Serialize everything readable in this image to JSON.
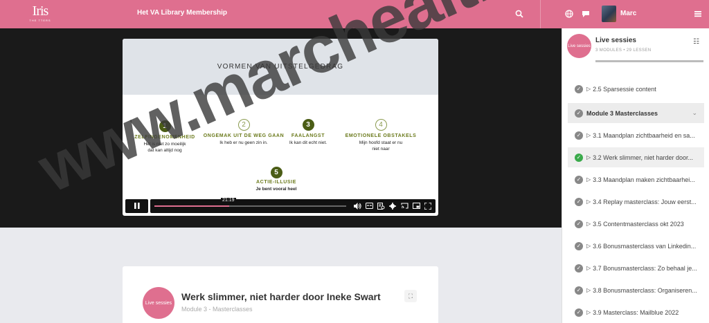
{
  "topbar": {
    "logo_mark": "Iris",
    "logo_sub": "THE TTERS",
    "site_title": "Het VA Library Membership",
    "user_name": "Marc"
  },
  "video": {
    "slide_title": "VORMEN VAN UITSTELGEDRAG",
    "points": [
      {
        "num": "1",
        "title": "ZELFINGENOMENHEID",
        "text": "Het is niet zo moeilijk dat kan altijd nog"
      },
      {
        "num": "2",
        "title": "ONGEMAK UIT DE WEG GAAN",
        "text": "Ik heb er nu geen zin in."
      },
      {
        "num": "3",
        "title": "FAALANGST",
        "text": "Ik kan dit echt niet."
      },
      {
        "num": "4",
        "title": "EMOTIONELE OBSTAKELS",
        "text": "Mijn hoofd staat er nu niet naar"
      },
      {
        "num": "5",
        "title": "ACTIE-ILLUSIE",
        "text": "Je bent vooral heel"
      }
    ],
    "time_tooltip": "21:19",
    "progress_fraction": 0.39
  },
  "lesson": {
    "badge": "Live sessies",
    "title": "Werk slimmer, niet harder door Ineke Swart",
    "subtitle": "Module 3 - Masterclasses"
  },
  "sidebar": {
    "badge": "Live sessies",
    "title": "Live sessies",
    "meta": "3 MODULES • 29 LESSEN",
    "items": [
      {
        "label": "2.5 Sparsessie content",
        "type": "lesson",
        "done": false
      },
      {
        "label": "Module 3   Masterclasses",
        "type": "module",
        "done": false
      },
      {
        "label": "3.1 Maandplan zichtbaarheid en sa...",
        "type": "lesson",
        "done": false
      },
      {
        "label": "3.2 Werk slimmer, niet harder door...",
        "type": "lesson",
        "done": true,
        "active": true
      },
      {
        "label": "3.3 Maandplan maken zichtbaarhei...",
        "type": "lesson",
        "done": false
      },
      {
        "label": "3.4 Replay masterclass: Jouw eerst...",
        "type": "lesson",
        "done": false
      },
      {
        "label": "3.5 Contentmasterclass okt 2023",
        "type": "lesson",
        "done": false
      },
      {
        "label": "3.6 Bonusmasterclass van Linkedin...",
        "type": "lesson",
        "done": false
      },
      {
        "label": "3.7 Bonusmasterclass: Zo behaal je...",
        "type": "lesson",
        "done": false
      },
      {
        "label": "3.8 Bonusmasterclass: Organiseren...",
        "type": "lesson",
        "done": false
      },
      {
        "label": "3.9 Masterclass: Mailblue 2022",
        "type": "lesson",
        "done": false
      }
    ]
  },
  "watermark": "www.marchealthy.nl",
  "colors": {
    "brand": "#df6f8f",
    "done": "#3aaa4b",
    "slide_accent": "#4b5d16"
  }
}
